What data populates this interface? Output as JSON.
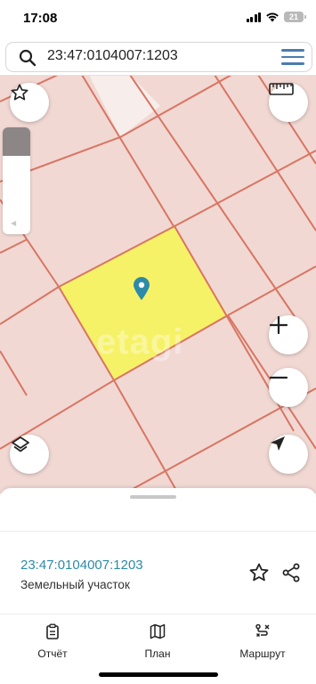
{
  "status_bar": {
    "time": "17:08",
    "battery": "21"
  },
  "search": {
    "value": "23:47:0104007:1203",
    "icon": "search-icon",
    "menu_icon": "hamburger-menu-icon"
  },
  "map": {
    "watermark": "etagi",
    "opacity_level": 0.27,
    "colors": {
      "background": "#f1d8d3",
      "boundary": "#d97563",
      "selected_parcel": "#f6f267",
      "marker": "#2d8aa8"
    },
    "controls": {
      "favorite_icon": "star-outline-icon",
      "ruler_icon": "ruler-icon",
      "zoom_in_icon": "plus-icon",
      "zoom_out_icon": "minus-icon",
      "layers_icon": "layers-icon",
      "locate_icon": "navigation-arrow-icon"
    }
  },
  "parcel": {
    "number": "23:47:0104007:1203",
    "type": "Земельный участок"
  },
  "nav": {
    "items": [
      {
        "label": "Отчёт",
        "icon": "clipboard-icon"
      },
      {
        "label": "План",
        "icon": "map-icon"
      },
      {
        "label": "Маршрут",
        "icon": "route-icon"
      }
    ]
  }
}
